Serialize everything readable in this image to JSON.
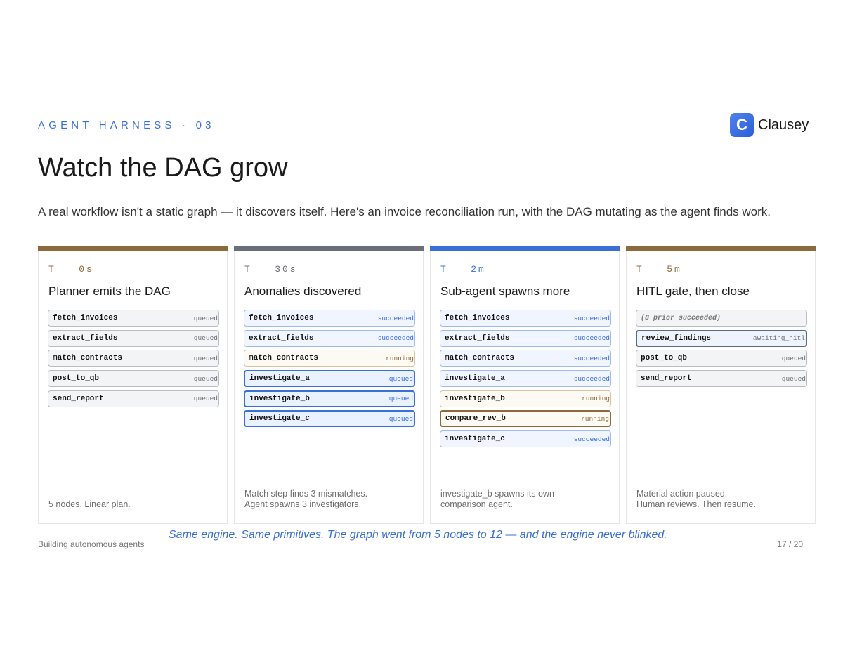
{
  "header": {
    "eyebrow": "AGENT HARNESS · 03",
    "title": "Watch the DAG grow",
    "subtitle": "A real workflow isn't a static graph — it discovers itself. Here's an invoice reconciliation run, with the DAG mutating as the agent finds work."
  },
  "brand": {
    "mark": "C",
    "name": "Clausey"
  },
  "colors": {
    "accent": "#3a6fd8",
    "bar_brown": "#8b6a3e",
    "bar_gray": "#6b6f7a",
    "bar_blue": "#3a6fd8"
  },
  "cards": [
    {
      "time": "T = 0s",
      "time_color": "#8b6a3e",
      "bar_color": "#8b6a3e",
      "title": "Planner emits the DAG",
      "nodes": [
        {
          "name": "fetch_invoices",
          "status": "queued"
        },
        {
          "name": "extract_fields",
          "status": "queued"
        },
        {
          "name": "match_contracts",
          "status": "queued"
        },
        {
          "name": "post_to_qb",
          "status": "queued"
        },
        {
          "name": "send_report",
          "status": "queued"
        }
      ],
      "caption": "5 nodes. Linear plan."
    },
    {
      "time": "T = 30s",
      "time_color": "#6b6f76",
      "bar_color": "#6b6f7a",
      "title": "Anomalies discovered",
      "nodes": [
        {
          "name": "fetch_invoices",
          "status": "succeeded"
        },
        {
          "name": "extract_fields",
          "status": "succeeded"
        },
        {
          "name": "match_contracts",
          "status": "running"
        },
        {
          "name": "investigate_a",
          "status": "queued"
        },
        {
          "name": "investigate_b",
          "status": "queued"
        },
        {
          "name": "investigate_c",
          "status": "queued"
        }
      ],
      "caption": "Match step finds 3 mismatches.\nAgent spawns 3 investigators."
    },
    {
      "time": "T = 2m",
      "time_color": "#3a6fd8",
      "bar_color": "#3a6fd8",
      "title": "Sub-agent spawns more",
      "nodes": [
        {
          "name": "fetch_invoices",
          "status": "succeeded"
        },
        {
          "name": "extract_fields",
          "status": "succeeded"
        },
        {
          "name": "match_contracts",
          "status": "succeeded"
        },
        {
          "name": "investigate_a",
          "status": "succeeded"
        },
        {
          "name": "investigate_b",
          "status": "running"
        },
        {
          "name": "compare_rev_b",
          "status": "running"
        },
        {
          "name": "investigate_c",
          "status": "succeeded"
        }
      ],
      "caption": "investigate_b spawns its own\ncomparison agent."
    },
    {
      "time": "T = 5m",
      "time_color": "#8b6a3e",
      "bar_color": "#8b6a3e",
      "title": "HITL gate, then close",
      "nodes": [
        {
          "name": "(8 prior succeeded)",
          "status": ""
        },
        {
          "name": "review_findings",
          "status": "awaiting_hitl"
        },
        {
          "name": "post_to_qb",
          "status": "queued"
        },
        {
          "name": "send_report",
          "status": "queued"
        }
      ],
      "caption": "Material action paused.\nHuman reviews. Then resume."
    }
  ],
  "footer": {
    "left": "Building autonomous agents",
    "quote": "Same engine. Same primitives. The graph went from 5 nodes to 12 — and the engine never blinked.",
    "page": "17 / 20"
  }
}
